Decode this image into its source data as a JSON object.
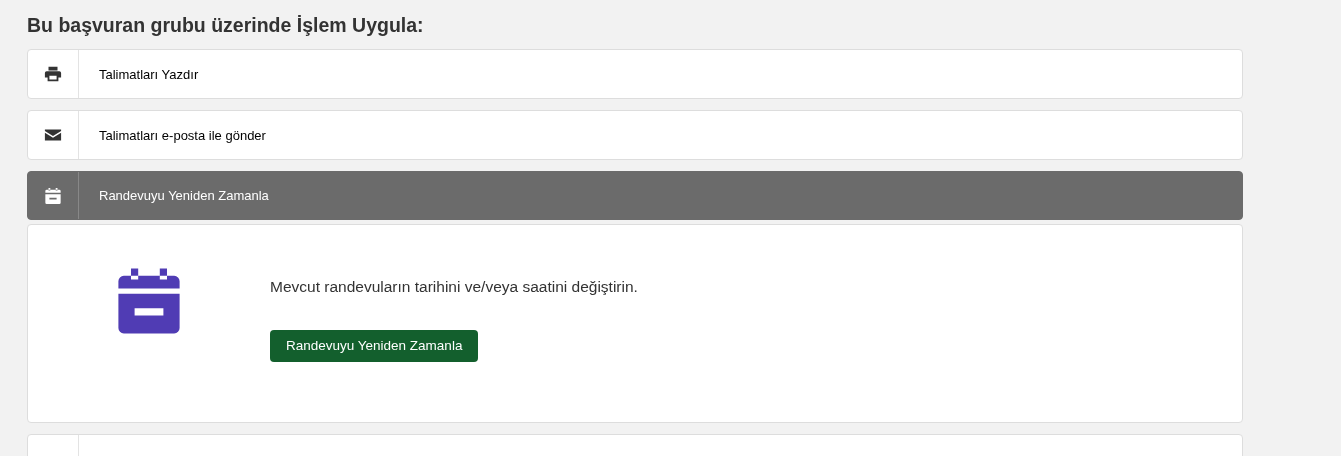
{
  "heading": "Bu başvuran grubu üzerinde İşlem Uygula:",
  "actions": [
    {
      "kind": "printer",
      "label": "Talimatları Yazdır",
      "expanded": false
    },
    {
      "kind": "envelope",
      "label": "Talimatları e-posta ile gönder",
      "expanded": false
    },
    {
      "kind": "calendar",
      "label": "Randevuyu Yeniden Zamanla",
      "expanded": true,
      "panel": {
        "description": "Mevcut randevuların tarihini ve/veya saatini değiştirin.",
        "button": "Randevuyu Yeniden Zamanla"
      }
    },
    {
      "kind": "blank",
      "expanded": false
    }
  ]
}
